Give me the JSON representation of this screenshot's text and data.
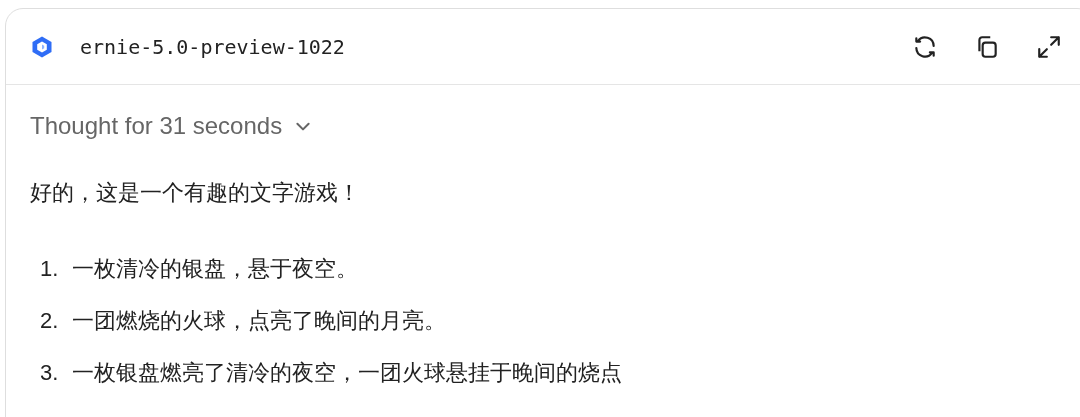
{
  "header": {
    "model_name": "ernie-5.0-preview-1022"
  },
  "thought": {
    "label": "Thought for 31 seconds",
    "expanded": false
  },
  "intro": "好的，这是一个有趣的文字游戏！",
  "items": [
    {
      "number": "1.",
      "text": "一枚清冷的银盘，悬于夜空。"
    },
    {
      "number": "2.",
      "text": "一团燃烧的火球，点亮了晚间的月亮。"
    },
    {
      "number": "3.",
      "text": "一枚银盘燃亮了清冷的夜空，一团火球悬挂于晚间的烧点"
    }
  ]
}
